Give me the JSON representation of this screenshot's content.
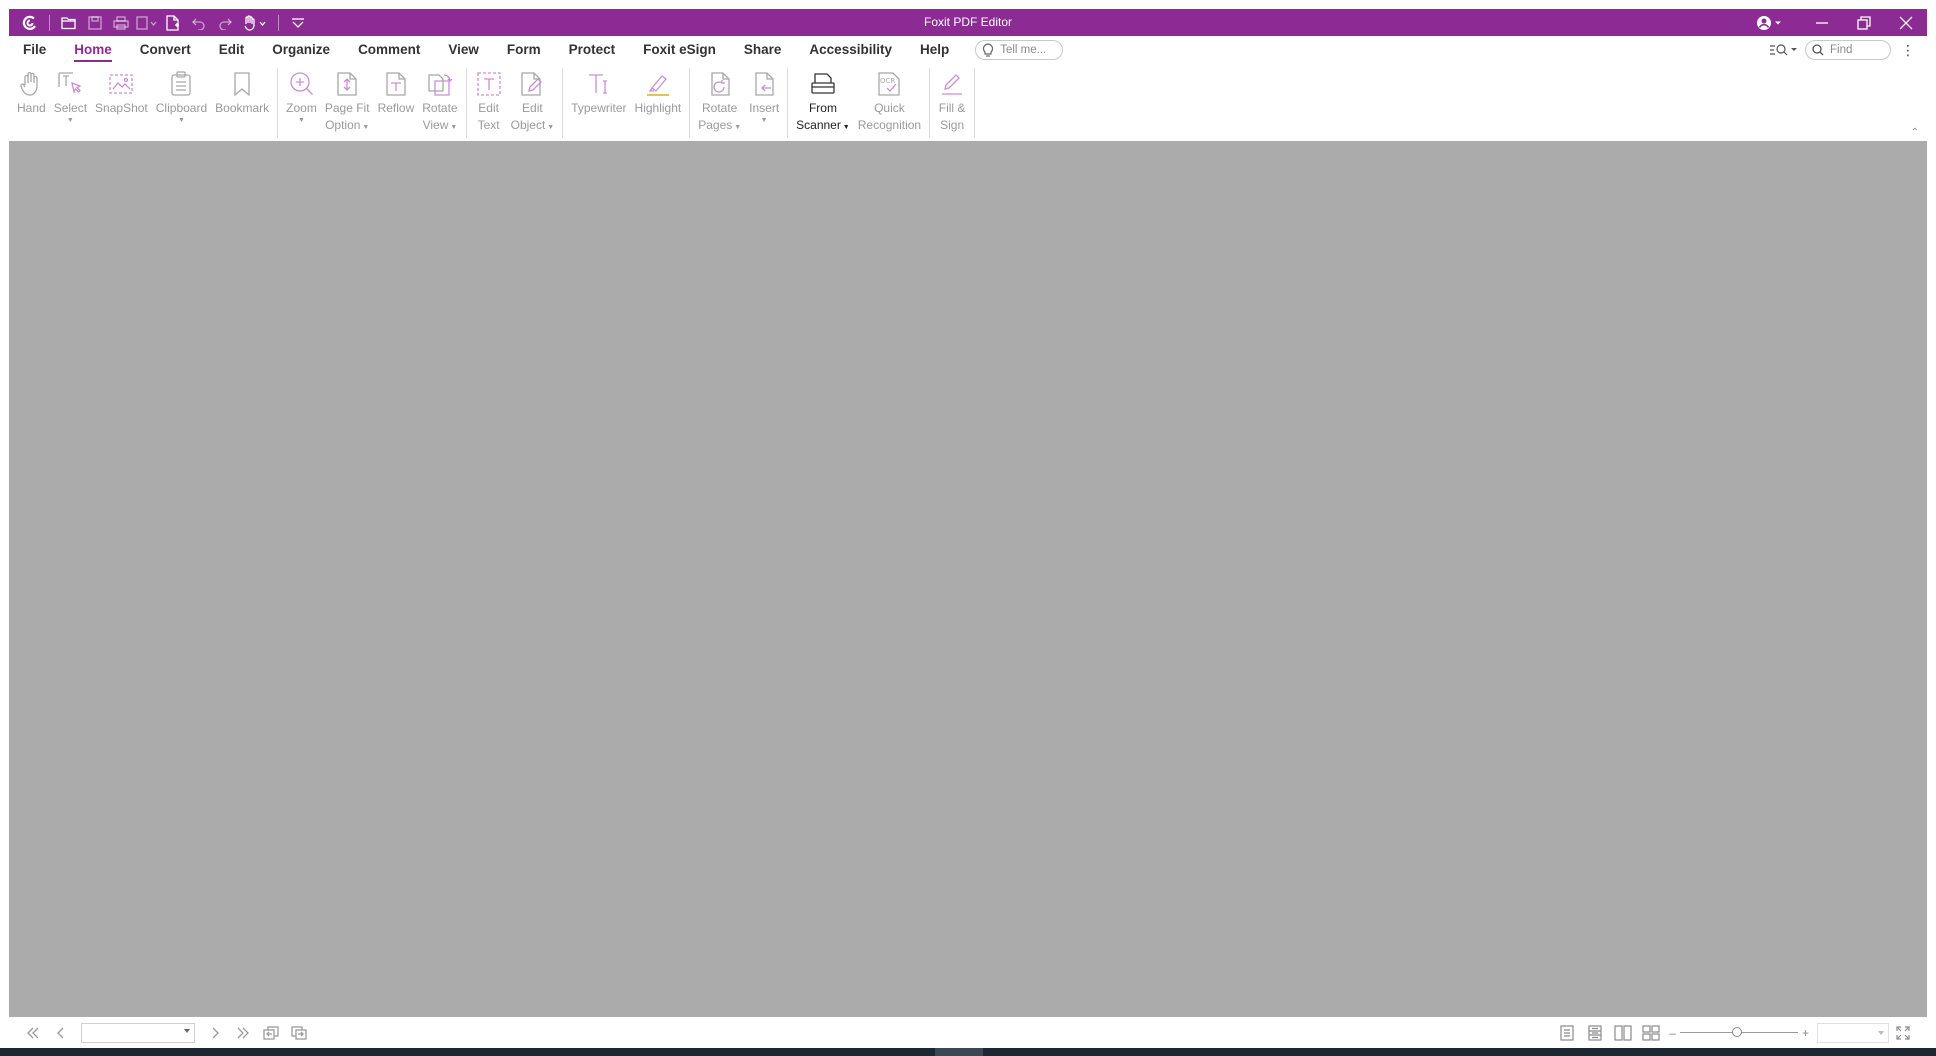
{
  "window": {
    "title": "Foxit PDF Editor",
    "accent_color": "#8d2b94"
  },
  "quick_access": [
    {
      "name": "foxit-logo-icon"
    },
    {
      "name": "open-folder-icon"
    },
    {
      "name": "save-icon"
    },
    {
      "name": "print-icon"
    },
    {
      "name": "file-menu-dropdown-icon"
    },
    {
      "name": "create-pdf-icon"
    },
    {
      "name": "undo-icon"
    },
    {
      "name": "redo-icon"
    },
    {
      "name": "hand-tool-dropdown-icon"
    },
    {
      "name": "customize-quick-access-icon"
    }
  ],
  "menu": {
    "tabs": [
      "File",
      "Home",
      "Convert",
      "Edit",
      "Organize",
      "Comment",
      "View",
      "Form",
      "Protect",
      "Foxit eSign",
      "Share",
      "Accessibility",
      "Help"
    ],
    "active_tab": "Home",
    "tell_me_placeholder": "Tell me...",
    "find_placeholder": "Find"
  },
  "ribbon": {
    "hand": "Hand",
    "select": "Select",
    "snapshot": "SnapShot",
    "clipboard": "Clipboard",
    "bookmark": "Bookmark",
    "zoom": "Zoom",
    "page_fit_1": "Page Fit",
    "page_fit_2": "Option",
    "reflow": "Reflow",
    "rotate_view_1": "Rotate",
    "rotate_view_2": "View",
    "edit_text_1": "Edit",
    "edit_text_2": "Text",
    "edit_object_1": "Edit",
    "edit_object_2": "Object",
    "typewriter": "Typewriter",
    "highlight": "Highlight",
    "rotate_pages_1": "Rotate",
    "rotate_pages_2": "Pages",
    "insert": "Insert",
    "from_scanner_1": "From",
    "from_scanner_2": "Scanner",
    "quick_recognition_1": "Quick",
    "quick_recognition_2": "Recognition",
    "fill_sign_1": "Fill &",
    "fill_sign_2": "Sign"
  },
  "document_area": {
    "background": "#ababab"
  },
  "statusbar": {
    "page_value": "",
    "zoom_value": ""
  }
}
